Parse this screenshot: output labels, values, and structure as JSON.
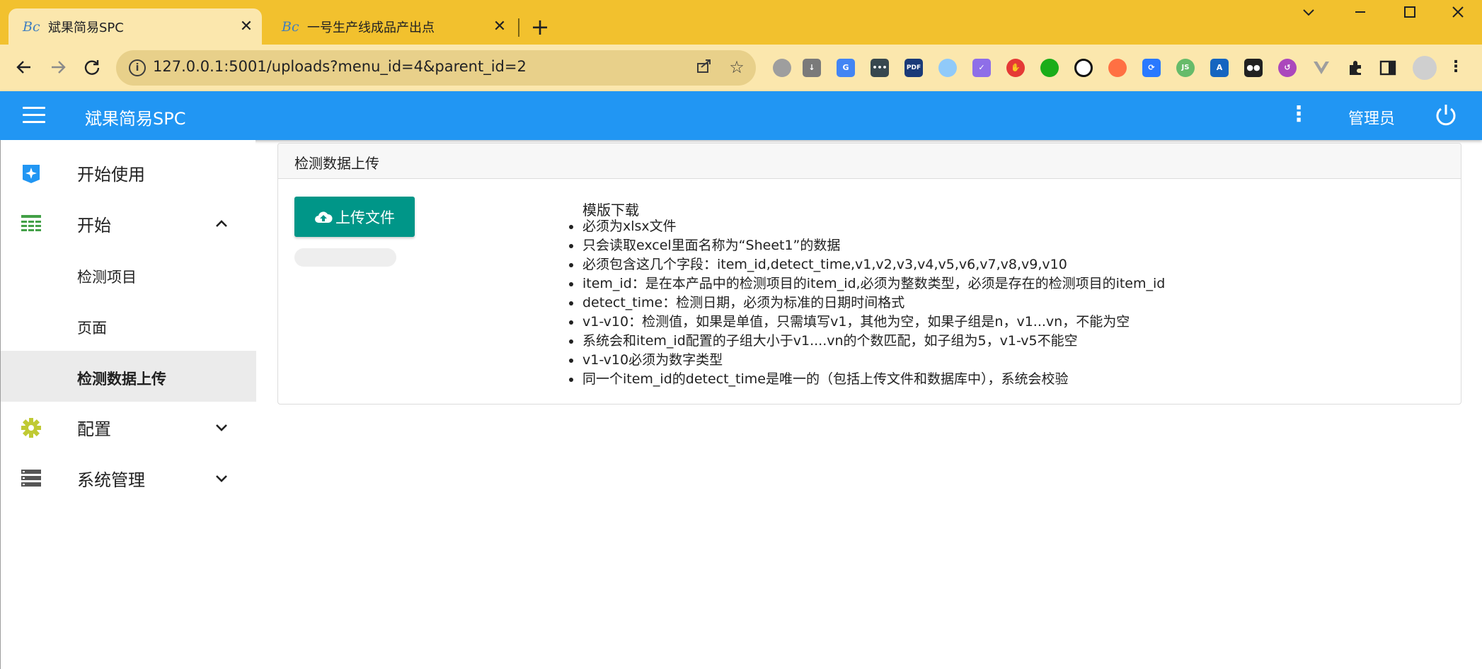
{
  "browser": {
    "tabs": [
      {
        "favicon": "Bc",
        "title": "斌果简易SPC",
        "active": true
      },
      {
        "favicon": "Bc",
        "title": "一号生产线成品产出点",
        "active": false
      }
    ],
    "url": "127.0.0.1:5001/uploads?menu_id=4&parent_id=2",
    "extensions": [
      "circle-ext-icon",
      "download-ext-icon",
      "translate-ext-icon",
      "dots-ext-icon",
      "pdf-ext-icon",
      "feather-ext-icon",
      "check-ext-icon",
      "shield-ext-icon",
      "chat-ext-icon",
      "block-ext-icon",
      "orange-ext-icon",
      "sync-ext-icon",
      "js-ext-icon",
      "font-ext-icon",
      "glasses-ext-icon",
      "history-ext-icon",
      "vue-ext-icon",
      "puzzle-icon",
      "sidepanel-icon",
      "profile-avatar",
      "kebab-menu-icon"
    ],
    "extension_labels": {
      "pdf": "PDF",
      "js": "JS",
      "font": "A"
    }
  },
  "app": {
    "title": "斌果简易SPC",
    "user": "管理员",
    "header_color": "#2196f3"
  },
  "sidebar": {
    "items": [
      {
        "label": "开始使用",
        "icon": "spark-badge-icon"
      },
      {
        "label": "开始",
        "icon": "table-icon",
        "expanded": true
      },
      {
        "label": "配置",
        "icon": "gear-icon",
        "expanded": false
      },
      {
        "label": "系统管理",
        "icon": "server-icon",
        "expanded": false
      }
    ],
    "sub_items": [
      {
        "label": "检测项目"
      },
      {
        "label": "页面"
      },
      {
        "label": "检测数据上传",
        "active": true
      }
    ]
  },
  "main": {
    "card_title": "检测数据上传",
    "upload_label": "上传文件",
    "upload_progress": 0,
    "accent_color": "#009688",
    "template_link": "模版下载",
    "rules": [
      "必须为xlsx文件",
      "只会读取excel里面名称为“Sheet1”的数据",
      "必须包含这几个字段：item_id,detect_time,v1,v2,v3,v4,v5,v6,v7,v8,v9,v10",
      "item_id：是在本产品中的检测项目的item_id,必须为整数类型，必须是存在的检测项目的item_id",
      "detect_time：检测日期，必须为标准的日期时间格式",
      "v1-v10：检测值，如果是单值，只需填写v1，其他为空，如果子组是n，v1...vn，不能为空",
      "系统会和item_id配置的子组大小于v1....vn的个数匹配，如子组为5，v1-v5不能空",
      "v1-v10必须为数字类型",
      "同一个item_id的detect_time是唯一的（包括上传文件和数据库中），系统会校验"
    ]
  }
}
